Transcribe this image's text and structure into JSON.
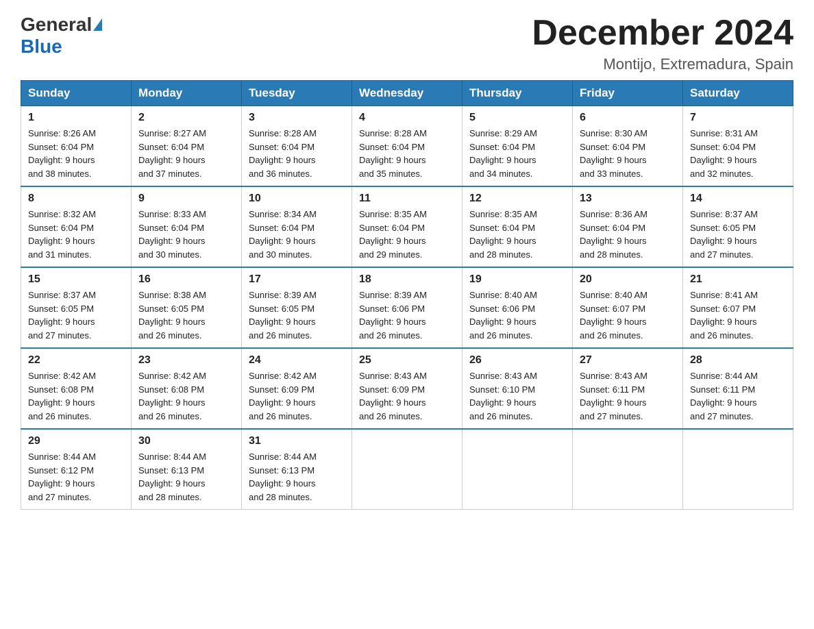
{
  "logo": {
    "general": "General",
    "blue": "Blue"
  },
  "title": "December 2024",
  "subtitle": "Montijo, Extremadura, Spain",
  "days_of_week": [
    "Sunday",
    "Monday",
    "Tuesday",
    "Wednesday",
    "Thursday",
    "Friday",
    "Saturday"
  ],
  "weeks": [
    [
      {
        "day": "1",
        "sunrise": "8:26 AM",
        "sunset": "6:04 PM",
        "daylight": "9 hours and 38 minutes."
      },
      {
        "day": "2",
        "sunrise": "8:27 AM",
        "sunset": "6:04 PM",
        "daylight": "9 hours and 37 minutes."
      },
      {
        "day": "3",
        "sunrise": "8:28 AM",
        "sunset": "6:04 PM",
        "daylight": "9 hours and 36 minutes."
      },
      {
        "day": "4",
        "sunrise": "8:28 AM",
        "sunset": "6:04 PM",
        "daylight": "9 hours and 35 minutes."
      },
      {
        "day": "5",
        "sunrise": "8:29 AM",
        "sunset": "6:04 PM",
        "daylight": "9 hours and 34 minutes."
      },
      {
        "day": "6",
        "sunrise": "8:30 AM",
        "sunset": "6:04 PM",
        "daylight": "9 hours and 33 minutes."
      },
      {
        "day": "7",
        "sunrise": "8:31 AM",
        "sunset": "6:04 PM",
        "daylight": "9 hours and 32 minutes."
      }
    ],
    [
      {
        "day": "8",
        "sunrise": "8:32 AM",
        "sunset": "6:04 PM",
        "daylight": "9 hours and 31 minutes."
      },
      {
        "day": "9",
        "sunrise": "8:33 AM",
        "sunset": "6:04 PM",
        "daylight": "9 hours and 30 minutes."
      },
      {
        "day": "10",
        "sunrise": "8:34 AM",
        "sunset": "6:04 PM",
        "daylight": "9 hours and 30 minutes."
      },
      {
        "day": "11",
        "sunrise": "8:35 AM",
        "sunset": "6:04 PM",
        "daylight": "9 hours and 29 minutes."
      },
      {
        "day": "12",
        "sunrise": "8:35 AM",
        "sunset": "6:04 PM",
        "daylight": "9 hours and 28 minutes."
      },
      {
        "day": "13",
        "sunrise": "8:36 AM",
        "sunset": "6:04 PM",
        "daylight": "9 hours and 28 minutes."
      },
      {
        "day": "14",
        "sunrise": "8:37 AM",
        "sunset": "6:05 PM",
        "daylight": "9 hours and 27 minutes."
      }
    ],
    [
      {
        "day": "15",
        "sunrise": "8:37 AM",
        "sunset": "6:05 PM",
        "daylight": "9 hours and 27 minutes."
      },
      {
        "day": "16",
        "sunrise": "8:38 AM",
        "sunset": "6:05 PM",
        "daylight": "9 hours and 26 minutes."
      },
      {
        "day": "17",
        "sunrise": "8:39 AM",
        "sunset": "6:05 PM",
        "daylight": "9 hours and 26 minutes."
      },
      {
        "day": "18",
        "sunrise": "8:39 AM",
        "sunset": "6:06 PM",
        "daylight": "9 hours and 26 minutes."
      },
      {
        "day": "19",
        "sunrise": "8:40 AM",
        "sunset": "6:06 PM",
        "daylight": "9 hours and 26 minutes."
      },
      {
        "day": "20",
        "sunrise": "8:40 AM",
        "sunset": "6:07 PM",
        "daylight": "9 hours and 26 minutes."
      },
      {
        "day": "21",
        "sunrise": "8:41 AM",
        "sunset": "6:07 PM",
        "daylight": "9 hours and 26 minutes."
      }
    ],
    [
      {
        "day": "22",
        "sunrise": "8:42 AM",
        "sunset": "6:08 PM",
        "daylight": "9 hours and 26 minutes."
      },
      {
        "day": "23",
        "sunrise": "8:42 AM",
        "sunset": "6:08 PM",
        "daylight": "9 hours and 26 minutes."
      },
      {
        "day": "24",
        "sunrise": "8:42 AM",
        "sunset": "6:09 PM",
        "daylight": "9 hours and 26 minutes."
      },
      {
        "day": "25",
        "sunrise": "8:43 AM",
        "sunset": "6:09 PM",
        "daylight": "9 hours and 26 minutes."
      },
      {
        "day": "26",
        "sunrise": "8:43 AM",
        "sunset": "6:10 PM",
        "daylight": "9 hours and 26 minutes."
      },
      {
        "day": "27",
        "sunrise": "8:43 AM",
        "sunset": "6:11 PM",
        "daylight": "9 hours and 27 minutes."
      },
      {
        "day": "28",
        "sunrise": "8:44 AM",
        "sunset": "6:11 PM",
        "daylight": "9 hours and 27 minutes."
      }
    ],
    [
      {
        "day": "29",
        "sunrise": "8:44 AM",
        "sunset": "6:12 PM",
        "daylight": "9 hours and 27 minutes."
      },
      {
        "day": "30",
        "sunrise": "8:44 AM",
        "sunset": "6:13 PM",
        "daylight": "9 hours and 28 minutes."
      },
      {
        "day": "31",
        "sunrise": "8:44 AM",
        "sunset": "6:13 PM",
        "daylight": "9 hours and 28 minutes."
      },
      null,
      null,
      null,
      null
    ]
  ],
  "labels": {
    "sunrise": "Sunrise:",
    "sunset": "Sunset:",
    "daylight": "Daylight:"
  }
}
